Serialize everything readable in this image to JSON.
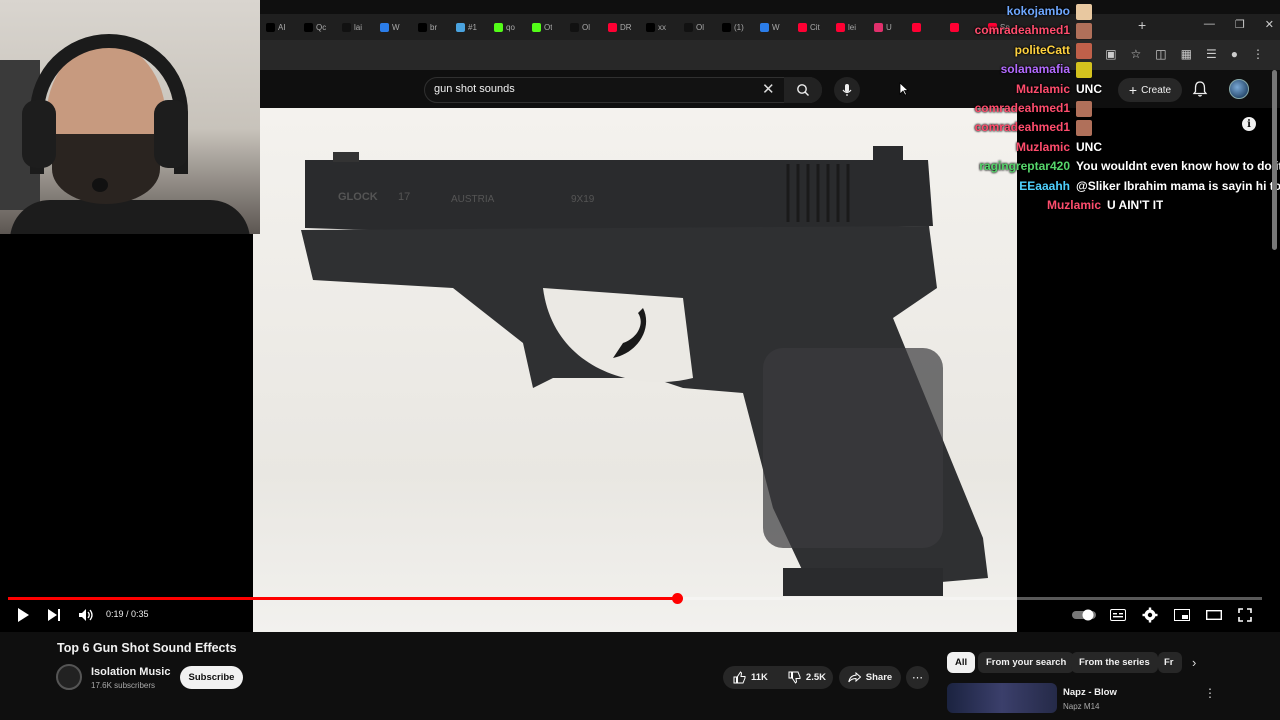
{
  "browser": {
    "tabs": [
      {
        "label": "AI",
        "color": "#000000"
      },
      {
        "label": "Qc",
        "color": "#000000"
      },
      {
        "label": "lai",
        "color": "#111111"
      },
      {
        "label": "W",
        "color": "#2b7de9"
      },
      {
        "label": "br",
        "color": "#000000"
      },
      {
        "label": "#1",
        "color": "#4aa3df"
      },
      {
        "label": "qo",
        "color": "#53fc18"
      },
      {
        "label": "Ot",
        "color": "#53fc18"
      },
      {
        "label": "Ol",
        "color": "#111111"
      },
      {
        "label": "DR",
        "color": "#ff0033"
      },
      {
        "label": "xx",
        "color": "#000000"
      },
      {
        "label": "Ol",
        "color": "#111111"
      },
      {
        "label": "(1)",
        "color": "#000000"
      },
      {
        "label": "W",
        "color": "#2b7de9"
      },
      {
        "label": "Cit",
        "color": "#ff0033"
      },
      {
        "label": "lei",
        "color": "#ff0033"
      },
      {
        "label": "U",
        "color": "#e1306c"
      },
      {
        "label": "",
        "color": "#ff0033"
      },
      {
        "label": "",
        "color": "#ff0033"
      },
      {
        "label": "Sp",
        "color": "#ff0033"
      }
    ],
    "new_tab": "+"
  },
  "youtube": {
    "search": {
      "query": "gun shot sounds"
    },
    "create_label": "Create"
  },
  "chat": [
    {
      "user": "kokojambo",
      "color": "#6fa8ff",
      "msg": "",
      "emote": "#e8c8a0"
    },
    {
      "user": "comradeahmed1",
      "color": "#ff4d6d",
      "msg": "",
      "emote": "#b0705a"
    },
    {
      "user": "politeCatt",
      "color": "#ffd23f",
      "msg": "",
      "emote": "#c0604a"
    },
    {
      "user": "solanamafia",
      "color": "#b36bff",
      "msg": "",
      "emote": "#d4c21e"
    },
    {
      "user": "Muzlamic",
      "color": "#ff4d6d",
      "msg": "UNC",
      "emote": ""
    },
    {
      "user": "comradeahmed1",
      "color": "#ff4d6d",
      "msg": "",
      "emote": "#b0705a"
    },
    {
      "user": "comradeahmed1",
      "color": "#ff4d6d",
      "msg": "",
      "emote": "#b0705a"
    },
    {
      "user": "Muzlamic",
      "color": "#ff4d6d",
      "msg": "UNC",
      "emote": ""
    },
    {
      "user": "ragingreptar420",
      "color": "#55d66b",
      "msg": "You wouldnt even know how to do it",
      "emote": ""
    },
    {
      "user": "EEaaahh",
      "color": "#4fd1ff",
      "msg": "@Sliker Ibrahim mama is sayin hi to y",
      "emote": ""
    },
    {
      "user": "Muzlamic",
      "color": "#ff4d6d",
      "msg": "U AIN'T IT",
      "emote": ""
    }
  ],
  "player": {
    "progress": 0.5333,
    "current_time": "0:19",
    "duration": "0:35",
    "time_display": "0:19 / 0:35"
  },
  "video": {
    "title": "Top 6 Gun Shot Sound Effects",
    "channel": "Isolation Music",
    "subscribers": "17.6K subscribers",
    "subscribe_label": "Subscribe",
    "likes": "11K",
    "dislikes": "2.5K",
    "share_label": "Share",
    "frame_text": {
      "brand": "GLOCK",
      "model": "17",
      "origin": "AUSTRIA",
      "caliber": "9X19"
    }
  },
  "chips": [
    "All",
    "From your search",
    "From the series",
    "Fr"
  ],
  "recommendation": {
    "title": "Napz - Blow",
    "channel": "Napz M14"
  },
  "colors": {
    "accent": "#ff0000",
    "bg": "#0f0f0f",
    "chip": "#272727"
  }
}
